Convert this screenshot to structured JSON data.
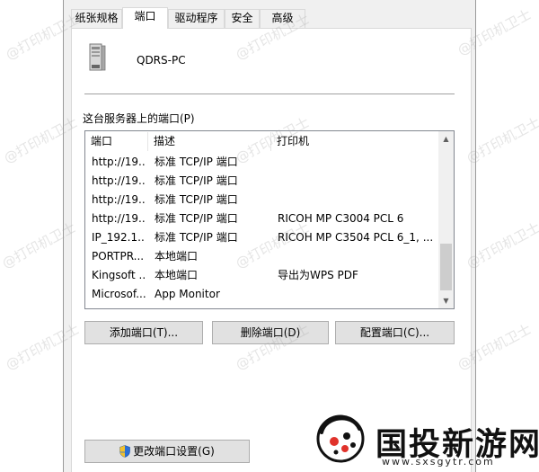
{
  "tabs": [
    {
      "label": "纸张规格",
      "active": false
    },
    {
      "label": "端口",
      "active": true
    },
    {
      "label": "驱动程序",
      "active": false
    },
    {
      "label": "安全",
      "active": false
    },
    {
      "label": "高级",
      "active": false
    }
  ],
  "server": {
    "name": "QDRS-PC",
    "icon": "server-tower-icon",
    "ports_label": "这台服务器上的端口(P)"
  },
  "ports_list": {
    "columns": [
      "端口",
      "描述",
      "打印机"
    ],
    "rows": [
      {
        "port": "http://19...",
        "description": "标准 TCP/IP 端口",
        "printer": ""
      },
      {
        "port": "http://19...",
        "description": "标准 TCP/IP 端口",
        "printer": ""
      },
      {
        "port": "http://19...",
        "description": "标准 TCP/IP 端口",
        "printer": ""
      },
      {
        "port": "http://19...",
        "description": "标准 TCP/IP 端口",
        "printer": "RICOH MP C3004 PCL 6"
      },
      {
        "port": "IP_192.1...",
        "description": "标准 TCP/IP 端口",
        "printer": "RICOH MP C3504 PCL 6_1, ..."
      },
      {
        "port": "PORTPR...",
        "description": "本地端口",
        "printer": ""
      },
      {
        "port": "Kingsoft ...",
        "description": "本地端口",
        "printer": "导出为WPS PDF"
      },
      {
        "port": "Microsof...",
        "description": "App Monitor",
        "printer": ""
      }
    ]
  },
  "buttons": {
    "add_port": "添加端口(T)...",
    "delete_port": "删除端口(D)",
    "configure_port": "配置端口(C)...",
    "change_settings": "更改端口设置(G)"
  },
  "watermark": "@打印机卫士",
  "brand": {
    "name": "国投新游网",
    "url": "www.sxsgytr.com"
  }
}
